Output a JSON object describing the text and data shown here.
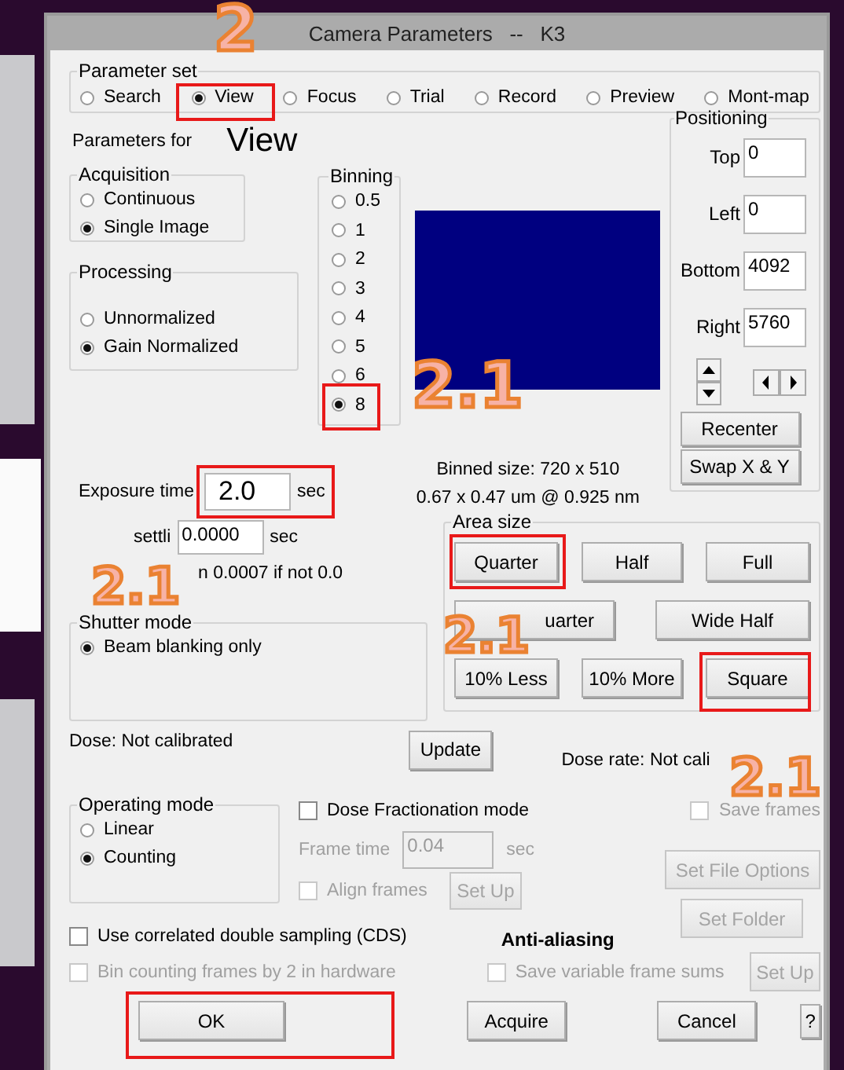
{
  "window": {
    "title": "Camera Parameters   --   K3"
  },
  "parameter_set": {
    "label": "Parameter set",
    "options": [
      {
        "label": "Search",
        "selected": false
      },
      {
        "label": "View",
        "selected": true
      },
      {
        "label": "Focus",
        "selected": false
      },
      {
        "label": "Trial",
        "selected": false
      },
      {
        "label": "Record",
        "selected": false
      },
      {
        "label": "Preview",
        "selected": false
      },
      {
        "label": "Mont-map",
        "selected": false
      }
    ]
  },
  "parameters_for": {
    "label": "Parameters for",
    "value": "View"
  },
  "acquisition": {
    "label": "Acquisition",
    "options": [
      {
        "label": "Continuous",
        "selected": false
      },
      {
        "label": "Single Image",
        "selected": true
      }
    ]
  },
  "processing": {
    "label": "Processing",
    "options": [
      {
        "label": "Unnormalized",
        "selected": false
      },
      {
        "label": "Gain Normalized",
        "selected": true
      }
    ]
  },
  "binning": {
    "label": "Binning",
    "options": [
      {
        "label": "0.5",
        "selected": false
      },
      {
        "label": "1",
        "selected": false
      },
      {
        "label": "2",
        "selected": false
      },
      {
        "label": "3",
        "selected": false
      },
      {
        "label": "4",
        "selected": false
      },
      {
        "label": "5",
        "selected": false
      },
      {
        "label": "6",
        "selected": false
      },
      {
        "label": "8",
        "selected": true
      }
    ]
  },
  "positioning": {
    "label": "Positioning",
    "fields": [
      {
        "label": "Top",
        "value": "0"
      },
      {
        "label": "Left",
        "value": "0"
      },
      {
        "label": "Bottom",
        "value": "4092"
      },
      {
        "label": "Right",
        "value": "5760"
      }
    ],
    "buttons": [
      {
        "label": "Recenter"
      },
      {
        "label": "Swap X & Y"
      }
    ]
  },
  "binned_size": "Binned size: 720 x 510",
  "pixel_size": "0.67 x 0.47 um @ 0.925 nm",
  "exposure": {
    "label": "Exposure time",
    "value": "2.0",
    "unit": "sec"
  },
  "drift_settling": {
    "label": "settli",
    "value": "0.0000",
    "unit": "sec",
    "note": "n 0.0007 if not 0.0"
  },
  "shutter_mode": {
    "label": "Shutter mode",
    "options": [
      {
        "label": "Beam blanking only",
        "selected": true
      }
    ]
  },
  "area_size": {
    "label": "Area size",
    "buttons": [
      {
        "parts": [
          "Quarter"
        ]
      },
      {
        "parts": [
          "Half"
        ]
      },
      {
        "parts": [
          "Full"
        ]
      },
      {
        "parts": [
          "uarter"
        ]
      },
      {
        "parts": [
          "Wide Half"
        ]
      },
      {
        "parts": [
          "10% Less"
        ]
      },
      {
        "parts": [
          "10% More"
        ]
      },
      {
        "parts": [
          "Square"
        ]
      }
    ]
  },
  "dose": "Dose: Not calibrated",
  "update_button": "Update",
  "dose_rate": "Dose rate: Not cali",
  "operating_mode": {
    "label": "Operating mode",
    "options": [
      {
        "label": "Linear",
        "selected": false
      },
      {
        "label": "Counting",
        "selected": true
      }
    ]
  },
  "dose_fractionation": {
    "label": "Dose Fractionation mode",
    "checked": false,
    "disabled": false
  },
  "save_frames": {
    "label": "Save frames",
    "checked": false,
    "disabled": true
  },
  "frame_time": {
    "label": "Frame time",
    "value": "0.04",
    "unit": "sec",
    "disabled": true
  },
  "align_frames": {
    "label": "Align frames",
    "checked": false,
    "disabled": true
  },
  "align_setup_button": {
    "label": "Set Up",
    "disabled": true
  },
  "set_file_options_button": {
    "label": "Set File Options",
    "disabled": true
  },
  "set_folder_button": {
    "label": "Set Folder",
    "disabled": true
  },
  "cds": {
    "label": "Use correlated double sampling (CDS)",
    "checked": false,
    "disabled": false
  },
  "anti_aliasing": "Anti-aliasing",
  "bin_counting": {
    "label": "Bin counting frames by 2 in hardware",
    "checked": false,
    "disabled": true
  },
  "save_variable_sums": {
    "label": "Save variable frame sums",
    "checked": false,
    "disabled": true
  },
  "sums_setup_button": {
    "label": "Set Up",
    "disabled": true
  },
  "buttons": [
    {
      "label": "OK"
    },
    {
      "label": "Acquire"
    },
    {
      "label": "Cancel"
    },
    {
      "label": "?"
    }
  ],
  "annotations": [
    {
      "text": "2"
    },
    {
      "text": "2.1"
    },
    {
      "text": "2.1"
    },
    {
      "text": "2.1"
    },
    {
      "text": "2.1"
    }
  ]
}
